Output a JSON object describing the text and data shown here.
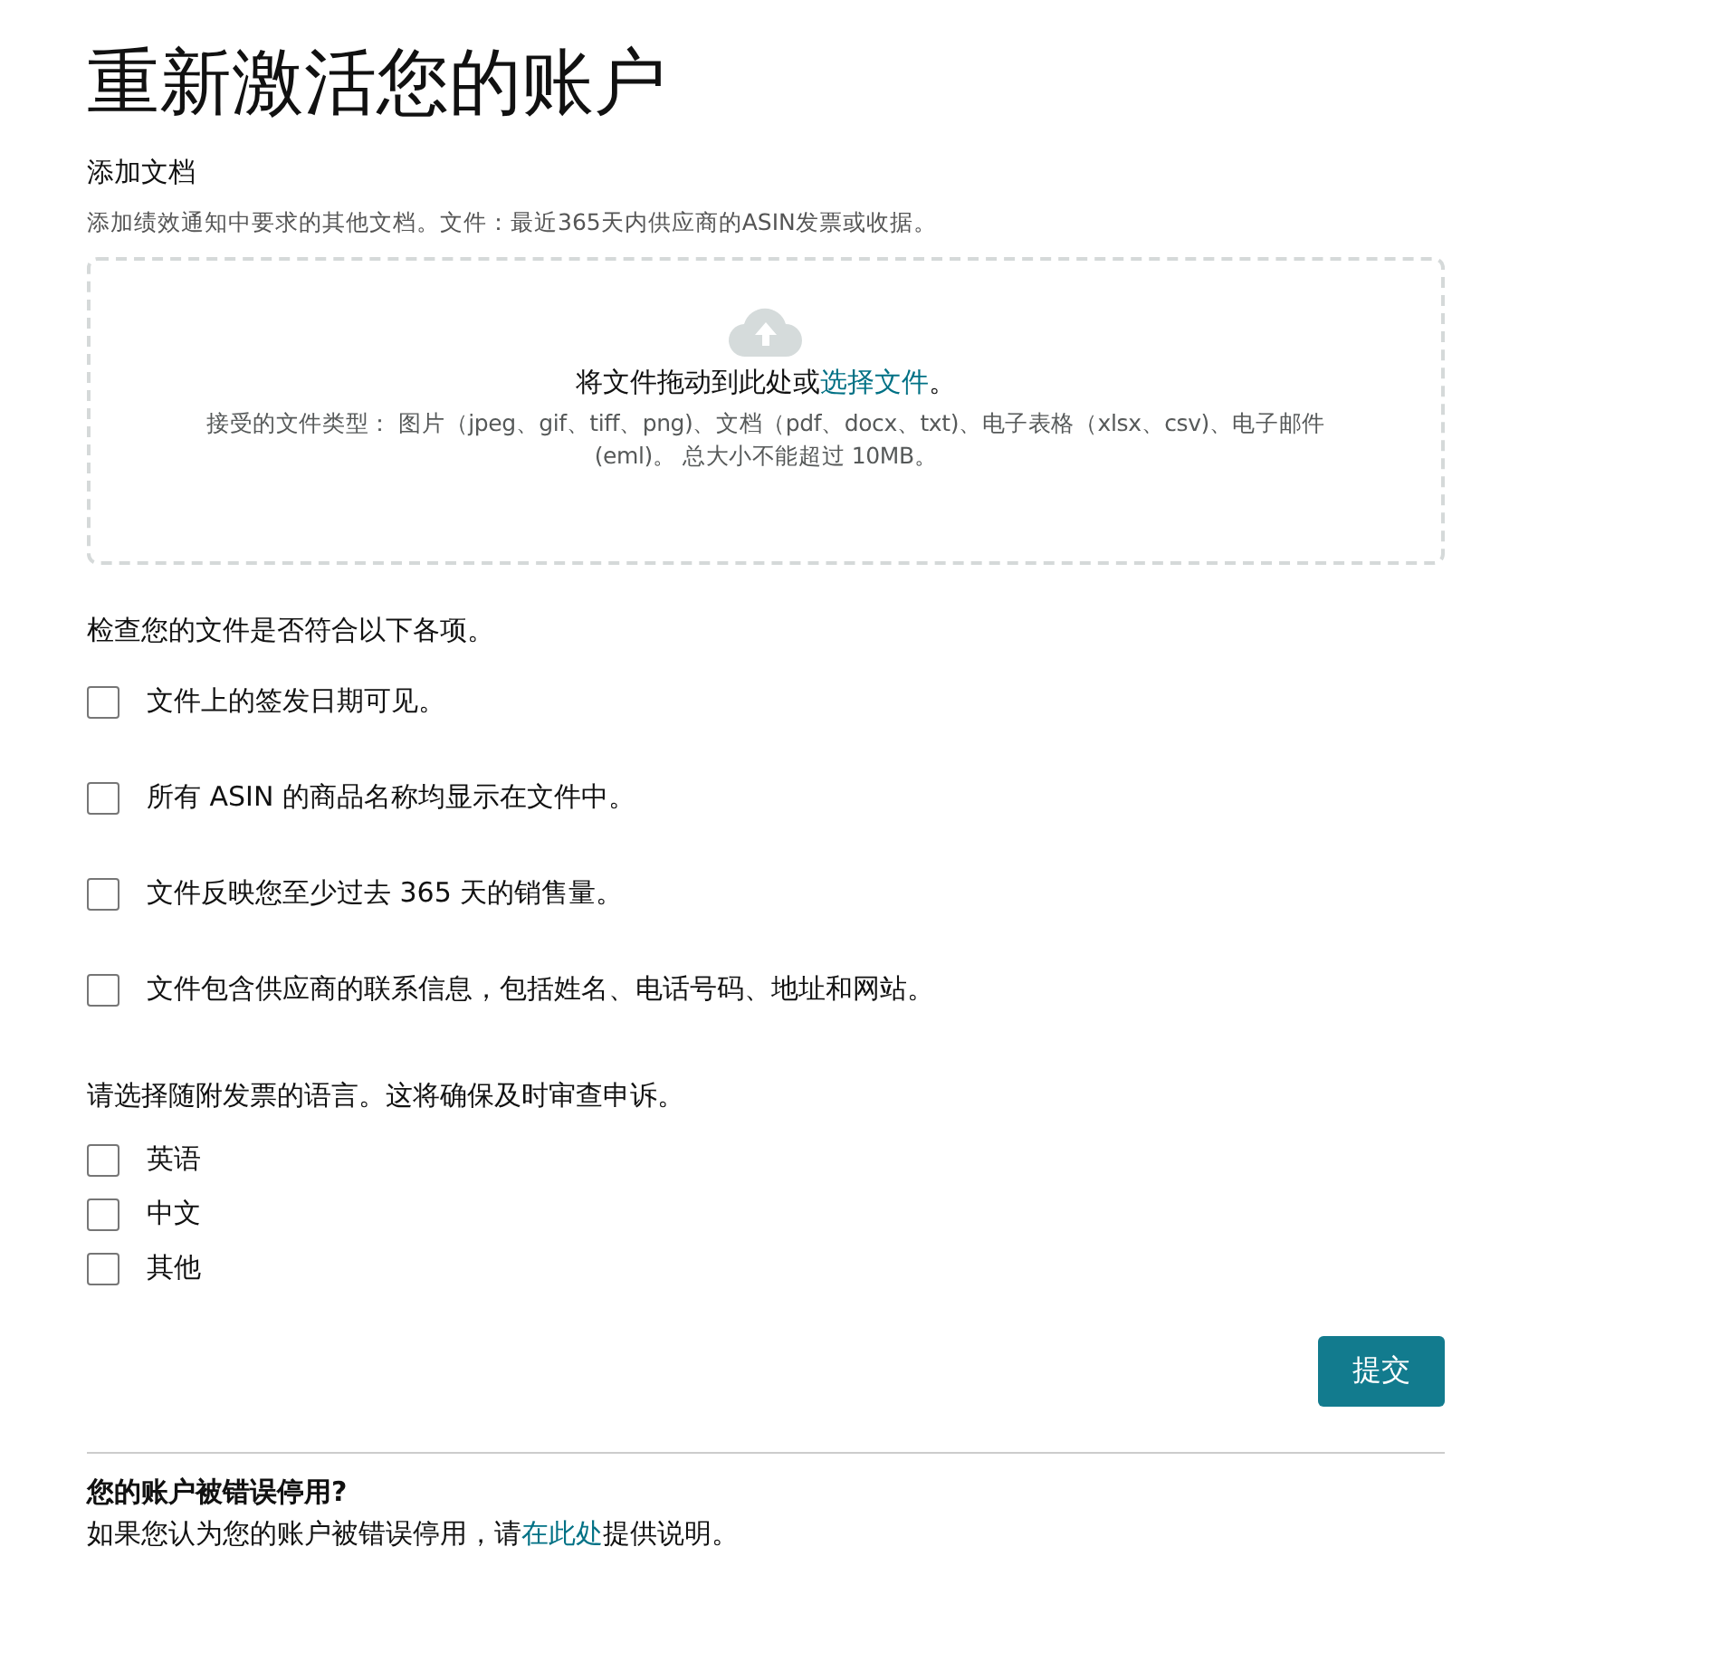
{
  "title": "重新激活您的账户",
  "documents": {
    "heading": "添加文档",
    "hint": "添加绩效通知中要求的其他文档。文件：最近365天内供应商的ASIN发票或收据。",
    "dropzone": {
      "prompt_before": "将文件拖动到此处或",
      "prompt_link": "选择文件",
      "prompt_after": "。",
      "accepted": "接受的文件类型： 图片（jpeg、gif、tiff、png)、文档（pdf、docx、txt)、电子表格（xlsx、csv)、电子邮件 (eml)。 总大小不能超过 10MB。"
    }
  },
  "checklist": {
    "heading": "检查您的文件是否符合以下各项。",
    "items": [
      {
        "label": "文件上的签发日期可见。",
        "checked": false
      },
      {
        "label": "所有 ASIN 的商品名称均显示在文件中。",
        "checked": false
      },
      {
        "label": "文件反映您至少过去 365 天的销售量。",
        "checked": false
      },
      {
        "label": "文件包含供应商的联系信息，包括姓名、电话号码、地址和网站。",
        "checked": false
      }
    ]
  },
  "language": {
    "heading": "请选择随附发票的语言。这将确保及时审查申诉。",
    "options": [
      {
        "label": "英语",
        "checked": false
      },
      {
        "label": "中文",
        "checked": false
      },
      {
        "label": "其他",
        "checked": false
      }
    ]
  },
  "submit_button": "提交",
  "footer": {
    "question": "您的账户被错误停用?",
    "text_before": "如果您认为您的账户被错误停用，请",
    "link": "在此处",
    "text_after": "提供说明。"
  }
}
